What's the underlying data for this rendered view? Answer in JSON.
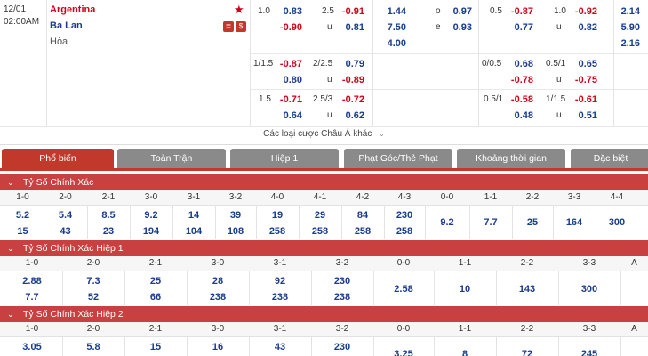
{
  "match": {
    "date": "12/01",
    "time": "02:00AM",
    "home": "Argentina",
    "away": "Ba Lan",
    "draw": "Hòa",
    "more_link": "Các loại cược Châu Á khác"
  },
  "odds": {
    "row1": {
      "hdp_line": "1.0",
      "hdp_home": "0.83",
      "hdp_away": "-0.90",
      "ou_line": "2.5",
      "ou_over": "-0.91",
      "ou_under_label": "u",
      "ou_under": "0.81",
      "x12_home": "1.44",
      "x12_away": "7.50",
      "x12_draw": "4.00",
      "oe_o_label": "o",
      "oe_o": "0.97",
      "oe_e_label": "e",
      "oe_e": "0.93",
      "h1_hdp_line": "0.5",
      "h1_hdp_home": "-0.87",
      "h1_hdp_away": "0.77",
      "h1_ou_line": "1.0",
      "h1_ou_over": "-0.92",
      "h1_ou_under_label": "u",
      "h1_ou_under": "0.82",
      "h1_x12_home": "2.14",
      "h1_x12_away": "5.90",
      "h1_x12_draw": "2.16"
    },
    "row2": {
      "hdp_line": "1/1.5",
      "hdp_home": "-0.87",
      "hdp_away": "0.80",
      "ou_line": "2/2.5",
      "ou_over": "0.79",
      "ou_under_label": "u",
      "ou_under": "-0.89",
      "h1_hdp_line": "0/0.5",
      "h1_hdp_home": "0.68",
      "h1_hdp_away": "-0.78",
      "h1_ou_line": "0.5/1",
      "h1_ou_over": "0.65",
      "h1_ou_under_label": "u",
      "h1_ou_under": "-0.75"
    },
    "row3": {
      "hdp_line": "1.5",
      "hdp_home": "-0.71",
      "hdp_away": "0.64",
      "ou_line": "2.5/3",
      "ou_over": "-0.72",
      "ou_under_label": "u",
      "ou_under": "0.62",
      "h1_hdp_line": "0.5/1",
      "h1_hdp_home": "-0.58",
      "h1_hdp_away": "0.48",
      "h1_ou_line": "1/1.5",
      "h1_ou_over": "-0.61",
      "h1_ou_under_label": "u",
      "h1_ou_under": "0.51"
    }
  },
  "tabs": [
    "Phổ biến",
    "Toàn Trận",
    "Hiệp 1",
    "Phạt Góc/Thẻ Phạt",
    "Khoảng thời gian",
    "Đặc biệt"
  ],
  "sections": {
    "cs_full": {
      "title": "Tỷ Số Chính Xác",
      "scores": [
        "1-0",
        "2-0",
        "2-1",
        "3-0",
        "3-1",
        "3-2",
        "4-0",
        "4-1",
        "4-2",
        "4-3",
        "0-0",
        "1-1",
        "2-2",
        "3-3",
        "4-4"
      ],
      "row_a": [
        "5.2",
        "5.4",
        "8.5",
        "9.2",
        "14",
        "39",
        "19",
        "29",
        "84",
        "230",
        "9.2",
        "7.7",
        "25",
        "164",
        "300"
      ],
      "row_b": [
        "15",
        "43",
        "23",
        "194",
        "104",
        "108",
        "258",
        "258",
        "258",
        "258"
      ]
    },
    "cs_h1": {
      "title": "Tỷ Số Chính Xác Hiệp 1",
      "scores": [
        "1-0",
        "2-0",
        "2-1",
        "3-0",
        "3-1",
        "3-2",
        "0-0",
        "1-1",
        "2-2",
        "3-3",
        "A"
      ],
      "row_a": [
        "2.88",
        "7.3",
        "25",
        "28",
        "92",
        "230"
      ],
      "row_b": [
        "7.7",
        "52",
        "66",
        "238",
        "238",
        "238"
      ],
      "draws": [
        "2.58",
        "10",
        "143",
        "300"
      ]
    },
    "cs_h2": {
      "title": "Tỷ Số Chính Xác Hiệp 2",
      "scores": [
        "1-0",
        "2-0",
        "2-1",
        "3-0",
        "3-1",
        "3-2",
        "0-0",
        "1-1",
        "2-2",
        "3-3",
        "A"
      ],
      "row_a": [
        "3.05",
        "5.8",
        "15",
        "16",
        "43",
        "230"
      ],
      "draws": [
        "3.25",
        "8",
        "72",
        "245"
      ]
    }
  },
  "colors": {
    "accent": "#c94040",
    "tab_inactive": "#8a8a8a",
    "positive": "#1a3c8c",
    "negative": "#d0021b"
  }
}
